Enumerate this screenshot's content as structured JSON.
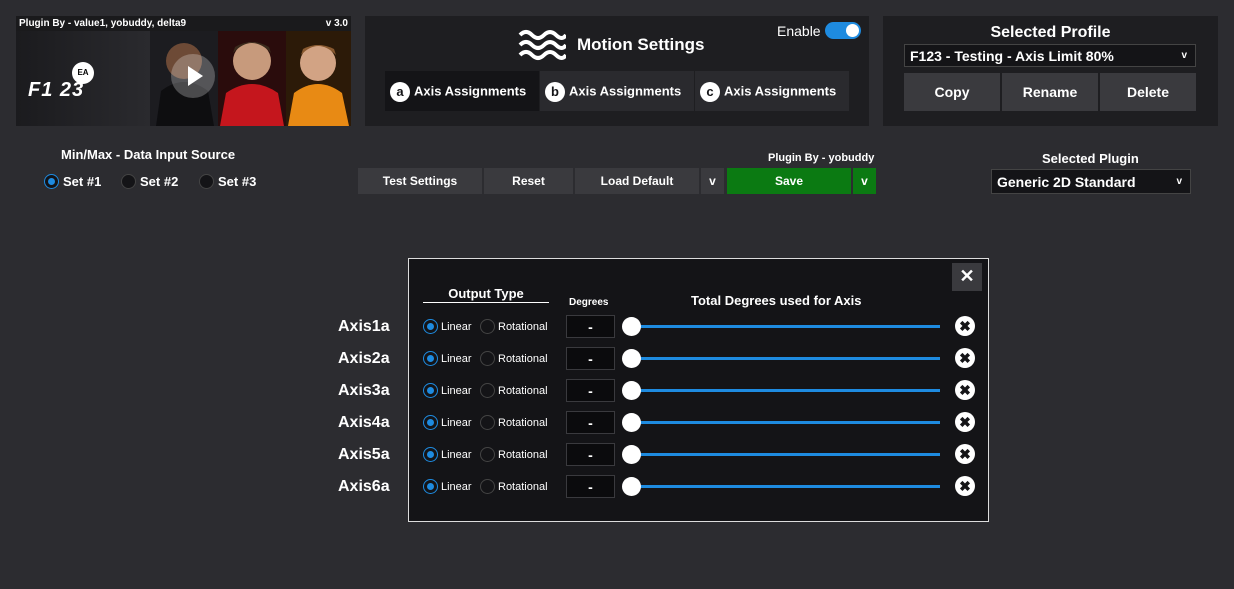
{
  "banner": {
    "credits": "Plugin By - value1, yobuddy, delta9",
    "version": "v 3.0",
    "game_logo": "F1 23",
    "ea_logo": "EA"
  },
  "motion": {
    "title": "Motion Settings",
    "enable_label": "Enable",
    "enabled": true,
    "icon": "waves-icon",
    "tabs": [
      {
        "badge": "a",
        "label": "Axis Assignments"
      },
      {
        "badge": "b",
        "label": "Axis Assignments"
      },
      {
        "badge": "c",
        "label": "Axis Assignments"
      }
    ]
  },
  "profile": {
    "title": "Selected Profile",
    "selected": "F123 - Testing - Axis Limit 80%",
    "caret": "v",
    "copy": "Copy",
    "rename": "Rename",
    "delete": "Delete"
  },
  "source": {
    "label": "Min/Max - Data Input Source",
    "options": [
      "Set #1",
      "Set #2",
      "Set #3"
    ],
    "selected_index": 0
  },
  "toolbar": {
    "test": "Test Settings",
    "reset": "Reset",
    "load_default": "Load Default",
    "load_caret": "v",
    "plugin_by": "Plugin By - yobuddy",
    "save": "Save",
    "save_caret": "v"
  },
  "plugin": {
    "label": "Selected Plugin",
    "selected": "Generic 2D Standard",
    "caret": "v"
  },
  "dialog": {
    "close": "✕",
    "output_type_header": "Output Type",
    "degrees_header": "Degrees",
    "total_header": "Total Degrees used for Axis",
    "linear_label": "Linear",
    "rotational_label": "Rotational",
    "axes": [
      {
        "name": "Axis1a",
        "type": "Linear",
        "degrees": "-",
        "slider": 0
      },
      {
        "name": "Axis2a",
        "type": "Linear",
        "degrees": "-",
        "slider": 0
      },
      {
        "name": "Axis3a",
        "type": "Linear",
        "degrees": "-",
        "slider": 0
      },
      {
        "name": "Axis4a",
        "type": "Linear",
        "degrees": "-",
        "slider": 0
      },
      {
        "name": "Axis5a",
        "type": "Linear",
        "degrees": "-",
        "slider": 0
      },
      {
        "name": "Axis6a",
        "type": "Linear",
        "degrees": "-",
        "slider": 0
      }
    ],
    "delete_glyph": "✖"
  },
  "colors": {
    "background": "#2c2c30",
    "panel": "#1e1e21",
    "accent": "#1e8be0",
    "save": "#0b7a12"
  }
}
